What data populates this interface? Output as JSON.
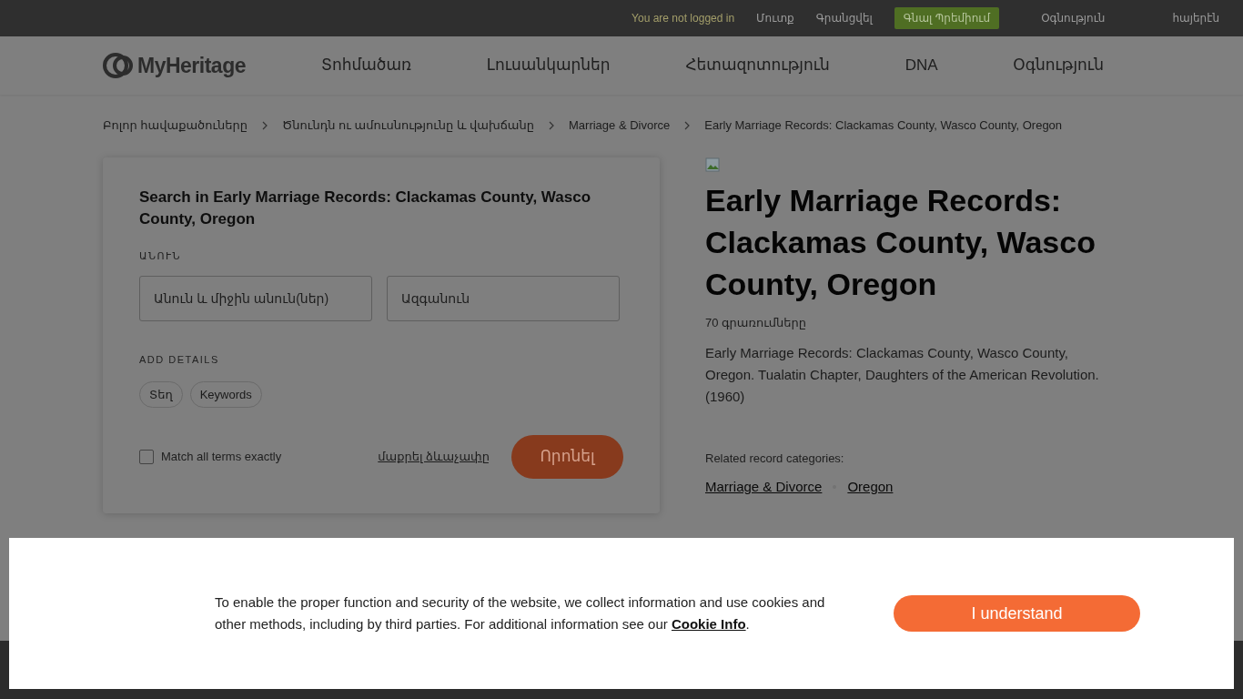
{
  "top_bar": {
    "status": "You are not logged in",
    "links": [
      "Մուտք",
      "Գրանցվել"
    ],
    "premium_button": "Գնալ Պրեմիում",
    "help": "Օգնություն",
    "language": "հայերէն"
  },
  "nav": {
    "logo_text": "MyHeritage",
    "items": [
      "Տոհմածառ",
      "Լուսանկարներ",
      "Հետազոտություն",
      "DNA",
      "Օգնություն"
    ]
  },
  "breadcrumbs": [
    "Բոլոր հավաքածուները",
    "Ծնունդն ու ամուսնությունը և վախճանը",
    "Marriage & Divorce",
    "Early Marriage Records: Clackamas County, Wasco County, Oregon"
  ],
  "search_card": {
    "title": "Search in Early Marriage Records: Clackamas County, Wasco County, Oregon",
    "name_label": "ԱՆՈՒՆ",
    "fields": [
      {
        "placeholder": "Անուն և միջին անուն(ներ)"
      },
      {
        "placeholder": "Ազգանուն"
      }
    ],
    "details_label": "ADD DETAILS",
    "detail_chips": [
      "Տեղ",
      "Keywords"
    ],
    "match_exact": {
      "label": "Match all terms exactly",
      "checked": false
    },
    "clear_link": "մաքրել ձևաչափը",
    "search_button": "Որոնել"
  },
  "collection": {
    "title": "Early Marriage Records: Clackamas County, Wasco County, Oregon",
    "count": "70 գրառումները",
    "description": "Early Marriage Records: Clackamas County, Wasco County, Oregon. Tualatin Chapter, Daughters of the American Revolution. (1960)",
    "related_label": "Related record categories:",
    "related": [
      "Marriage & Divorce",
      "Oregon"
    ]
  },
  "cookie_banner": {
    "text_before": "To enable the proper function and security of the website, we collect information and use cookies and other methods, including by third parties. For additional information see our ",
    "link": "Cookie Info",
    "text_after": ".",
    "button": "I understand"
  }
}
